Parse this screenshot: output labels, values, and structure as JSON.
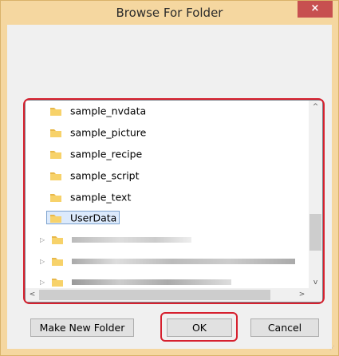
{
  "window": {
    "title": "Browse For Folder",
    "close_glyph": "×"
  },
  "tree": {
    "items": [
      {
        "label": "sample_nvdata",
        "icon": "folder-icon"
      },
      {
        "label": "sample_picture",
        "icon": "folder-icon"
      },
      {
        "label": "sample_recipe",
        "icon": "folder-icon"
      },
      {
        "label": "sample_script",
        "icon": "folder-icon"
      },
      {
        "label": "sample_text",
        "icon": "folder-icon"
      },
      {
        "label": "UserData",
        "icon": "folder-icon",
        "selected": true
      }
    ],
    "collapsed_items_count_label": "",
    "expander_glyph": "▷"
  },
  "scroll": {
    "up": "^",
    "down": "v",
    "left": "<",
    "right": ">"
  },
  "buttons": {
    "make_new_folder": "Make New Folder",
    "ok": "OK",
    "cancel": "Cancel"
  },
  "colors": {
    "titlebar": "#f5d7a0",
    "close": "#c75050",
    "highlight": "#d6202e",
    "selection": "#dceafc"
  }
}
